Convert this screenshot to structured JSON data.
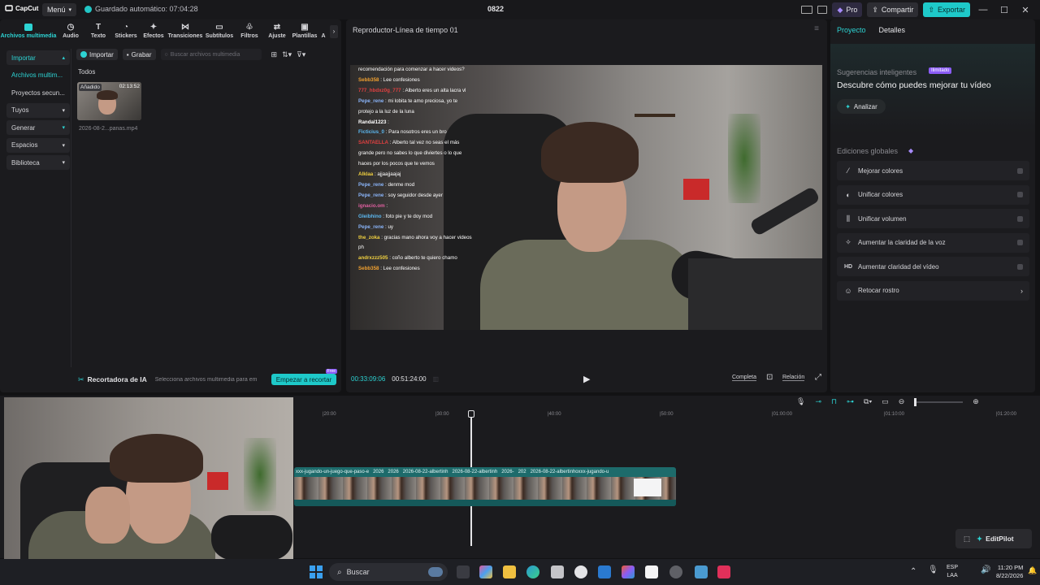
{
  "app": {
    "logo_text": "CapCut",
    "menu_label": "Menú",
    "autosave_text": "Guardado automático: 07:04:28",
    "project_title": "0822",
    "pro_label": "Pro",
    "share_label": "Compartir",
    "export_label": "Exportar",
    "accent": "#2dd4d4"
  },
  "toolbar": {
    "tools": [
      {
        "label": "Archivos multimedia",
        "icon": "media-icon"
      },
      {
        "label": "Audio",
        "icon": "audio-icon"
      },
      {
        "label": "Texto",
        "icon": "text-icon"
      },
      {
        "label": "Stickers",
        "icon": "sticker-icon"
      },
      {
        "label": "Efectos",
        "icon": "effects-icon"
      },
      {
        "label": "Transiciones",
        "icon": "transitions-icon"
      },
      {
        "label": "Subtítulos",
        "icon": "subtitles-icon"
      },
      {
        "label": "Filtros",
        "icon": "filters-icon"
      },
      {
        "label": "Ajuste",
        "icon": "adjust-icon"
      },
      {
        "label": "Plantillas",
        "icon": "templates-icon"
      },
      {
        "label": "A",
        "icon": "more-icon"
      }
    ]
  },
  "sidebar": {
    "items": [
      {
        "label": "Importar"
      },
      {
        "label": "Archivos multim..."
      },
      {
        "label": "Proyectos secun..."
      },
      {
        "label": "Tuyos"
      },
      {
        "label": "Generar"
      },
      {
        "label": "Espacios"
      },
      {
        "label": "Biblioteca"
      }
    ]
  },
  "media": {
    "import_label": "Importar",
    "record_label": "Grabar",
    "search_placeholder": "Buscar archivos multimedia",
    "filter_label": "Todos",
    "thumb_badge": "Añadido",
    "thumb_duration": "02:13:52",
    "thumb_filename": "2026-08-2...panas.mp4"
  },
  "ai_bar": {
    "title": "Recortadora de IA",
    "hint": "Selecciona archivos multimedia para em",
    "button": "Empezar a recortar",
    "badge": "Free"
  },
  "player": {
    "title": "Reproductor-Línea de tiempo 01",
    "current_time": "00:33:09:06",
    "total_time": "00:51:24:00",
    "full_label": "Completa",
    "ratio_label": "Relación",
    "chat": [
      {
        "user": "",
        "text": "recomendación para comenzar a hacer videos?",
        "color": "#ffffff"
      },
      {
        "user": "Sebb358",
        "text": ": Lee confesiones",
        "color": "#f0a030"
      },
      {
        "user": "777_hbdxz0g_777",
        "text": ": Alberto eres un alta lacra vl",
        "color": "#e04040"
      },
      {
        "user": "Pepe_rene",
        "text": ": mi lobita te amo preciosa, yo te protejo a la luz de la luna",
        "color": "#8ab4f8"
      },
      {
        "user": "Randal1223",
        "text": ":",
        "color": "#ffffff"
      },
      {
        "user": "Ficticius_0",
        "text": ": Para nosotros eres un bro",
        "color": "#5cb8f0"
      },
      {
        "user": "SANTAELLA",
        "text": ": Alberto tal vez no seas el más grande pero no sabes lo que diviertes o lo que haces por los pocos que te vemos",
        "color": "#e04040"
      },
      {
        "user": "Alklaa",
        "text": ": ajjaajjaajaj",
        "color": "#f0d040"
      },
      {
        "user": "Pepe_rene",
        "text": ": denme mod",
        "color": "#8ab4f8"
      },
      {
        "user": "Pepe_rene",
        "text": ": soy seguidor desde ayer",
        "color": "#8ab4f8"
      },
      {
        "user": "ignacio.om",
        "text": ":",
        "color": "#e060a0"
      },
      {
        "user": "Gleibhino",
        "text": ": foto pie y te doy mod",
        "color": "#5cb8f0"
      },
      {
        "user": "Pepe_rene",
        "text": ": uy",
        "color": "#8ab4f8"
      },
      {
        "user": "the_zoka",
        "text": ": gracias mano ahora voy a hacer videos ph",
        "color": "#f0d040"
      },
      {
        "user": "andrxzzz505",
        "text": ": coño alberto te quiero chamo",
        "color": "#f0d040"
      },
      {
        "user": "Sebb358",
        "text": ": Lee confesiones",
        "color": "#f0a030"
      }
    ]
  },
  "right_panel": {
    "tab_project": "Proyecto",
    "tab_details": "Detalles",
    "smart_title": "Sugerencias inteligentes",
    "smart_badge": "Ilimitado",
    "headline": "Descubre cómo puedes mejorar tu vídeo",
    "analyze_label": "Analizar",
    "global_title": "Ediciones globales",
    "options": [
      {
        "label": "Mejorar colores",
        "icon": "wand-icon"
      },
      {
        "label": "Unificar colores",
        "icon": "color-icon"
      },
      {
        "label": "Unificar volumen",
        "icon": "volume-bars-icon"
      },
      {
        "label": "Aumentar la claridad de la voz",
        "icon": "voice-icon"
      },
      {
        "label": "Aumentar claridad del vídeo",
        "icon": "hd-icon"
      },
      {
        "label": "Retocar rostro",
        "icon": "face-icon"
      }
    ]
  },
  "timeline": {
    "ruler_labels": [
      "|20:00",
      "|30:00",
      "|40:00",
      "|50:00",
      "|01:00:00",
      "|01:10:00",
      "|01:20:00"
    ],
    "clip_titles": [
      "xxx-jugando-un-juego-que-paso-e",
      "2026",
      "2026",
      "2026-08-22-albertinh",
      "2026-08-22-albertinh",
      "2026-",
      "202",
      "2026-08-22-albertinhoxxx-jugando-u"
    ],
    "editpilot_label": "EditPilot"
  },
  "taskbar": {
    "search_label": "Buscar",
    "lang_top": "ESP",
    "lang_bottom": "LAA",
    "time": "11:20 PM",
    "date": "8/22/2026"
  }
}
